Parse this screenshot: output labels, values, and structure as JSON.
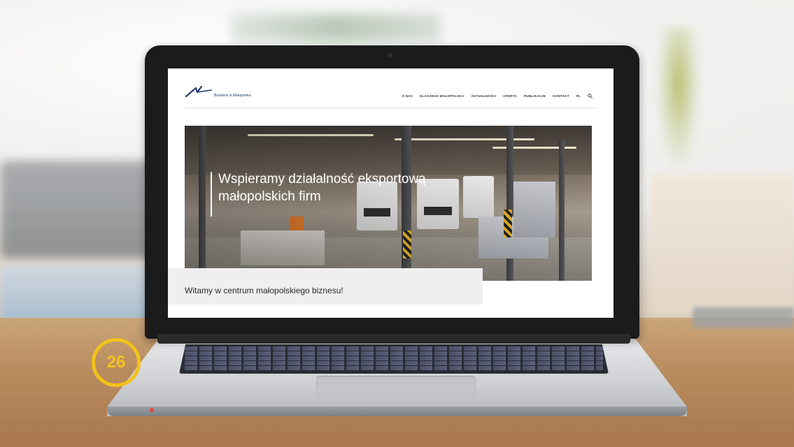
{
  "website": {
    "logo_text": "Business in Małopolska",
    "nav": [
      "O NAS",
      "DLACZEGO MAŁOPOLSKA",
      "AKTUALNOŚCI",
      "OFERTA",
      "PUBLIKACJE",
      "KONTAKT",
      "PL"
    ],
    "hero_title_line1": "Wspieramy działalność eksportową",
    "hero_title_line2": "małopolskich firm",
    "welcome": "Witamy w centrum małopolskiego biznesu!"
  },
  "badge": {
    "number": "26",
    "color": "#f2c21b"
  },
  "icons": [
    "search-icon",
    "logo-mark-icon"
  ],
  "colors": {
    "brand": "#1f3a6e",
    "accent": "#f2c21b",
    "welcome_bg": "#efefef"
  }
}
